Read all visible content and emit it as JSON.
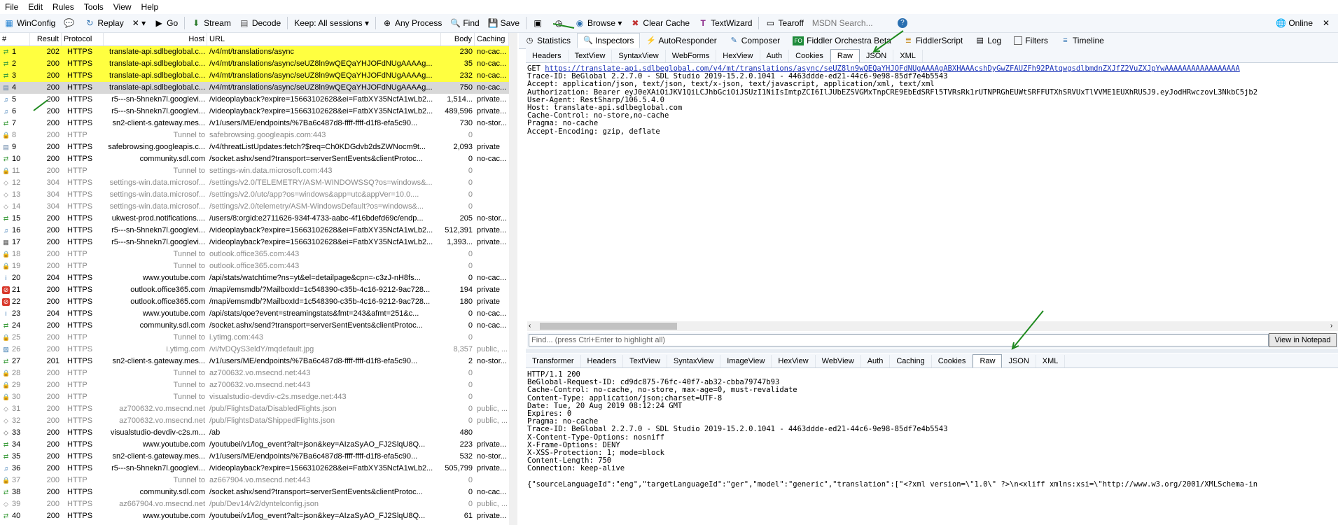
{
  "menu": [
    "File",
    "Edit",
    "Rules",
    "Tools",
    "View",
    "Help"
  ],
  "toolbar": {
    "winconfig": "WinConfig",
    "replay": "Replay",
    "remove": "✕ ▾",
    "go": "Go",
    "stream": "Stream",
    "decode": "Decode",
    "keep": "Keep: All sessions ▾",
    "any_process": "Any Process",
    "find": "Find",
    "save": "Save",
    "browse": "Browse ▾",
    "clear_cache": "Clear Cache",
    "textwizard": "TextWizard",
    "tearoff": "Tearoff",
    "msdn_search": "MSDN Search...",
    "online": "Online"
  },
  "columns": [
    "#",
    "Result",
    "Protocol",
    "Host",
    "URL",
    "Body",
    "Caching"
  ],
  "sessions": [
    {
      "id": "1",
      "result": "202",
      "protocol": "HTTPS",
      "host": "translate-api.sdlbeglobal.c...",
      "url": "/v4/mt/translations/async",
      "body": "230",
      "caching": "no-cac...",
      "style": "hl",
      "icon": "arrow",
      "color": "#3a9c3a"
    },
    {
      "id": "2",
      "result": "200",
      "protocol": "HTTPS",
      "host": "translate-api.sdlbeglobal.c...",
      "url": "/v4/mt/translations/async/seUZ8ln9wQEQaYHJOFdNUgAAAAg...",
      "body": "35",
      "caching": "no-cac...",
      "style": "hl",
      "icon": "arrow",
      "color": "#3a9c3a"
    },
    {
      "id": "3",
      "result": "200",
      "protocol": "HTTPS",
      "host": "translate-api.sdlbeglobal.c...",
      "url": "/v4/mt/translations/async/seUZ8ln9wQEQaYHJOFdNUgAAAAg...",
      "body": "232",
      "caching": "no-cac...",
      "style": "hl",
      "icon": "arrow",
      "color": "#3a9c3a"
    },
    {
      "id": "4",
      "result": "200",
      "protocol": "HTTPS",
      "host": "translate-api.sdlbeglobal.c...",
      "url": "/v4/mt/translations/async/seUZ8ln9wQEQaYHJOFdNUgAAAAg...",
      "body": "750",
      "caching": "no-cac...",
      "style": "sel",
      "icon": "doc",
      "color": "#5a7aa0"
    },
    {
      "id": "5",
      "result": "200",
      "protocol": "HTTPS",
      "host": "r5---sn-5hnekn7l.googlevi...",
      "url": "/videoplayback?expire=15663102628&ei=FatbXY35NcfA1wLb2...",
      "body": "1,514...",
      "caching": "private...",
      "style": "",
      "icon": "music",
      "color": "#2a6fb0"
    },
    {
      "id": "6",
      "result": "200",
      "protocol": "HTTPS",
      "host": "r5---sn-5hnekn7l.googlevi...",
      "url": "/videoplayback?expire=15663102628&ei=FatbXY35NcfA1wLb2...",
      "body": "489,596",
      "caching": "private...",
      "style": "",
      "icon": "music",
      "color": "#2a6fb0"
    },
    {
      "id": "7",
      "result": "200",
      "protocol": "HTTPS",
      "host": "sn2-client-s.gateway.mes...",
      "url": "/v1/users/ME/endpoints/%7Ba6c487d8-ffff-ffff-d1f8-efa5c90...",
      "body": "730",
      "caching": "no-stor...",
      "style": "",
      "icon": "arrow",
      "color": "#3a9c3a"
    },
    {
      "id": "8",
      "result": "200",
      "protocol": "HTTP",
      "host": "Tunnel to",
      "url": "safebrowsing.googleapis.com:443",
      "body": "0",
      "caching": "",
      "style": "grey",
      "icon": "lock",
      "color": "#888"
    },
    {
      "id": "9",
      "result": "200",
      "protocol": "HTTPS",
      "host": "safebrowsing.googleapis.c...",
      "url": "/v4/threatListUpdates:fetch?$req=Ch0KDGdvb2dsZWNocm9t...",
      "body": "2,093",
      "caching": "private",
      "style": "",
      "icon": "doc",
      "color": "#5a7aa0"
    },
    {
      "id": "10",
      "result": "200",
      "protocol": "HTTPS",
      "host": "community.sdl.com",
      "url": "/socket.ashx/send?transport=serverSentEvents&clientProtoc...",
      "body": "0",
      "caching": "no-cac...",
      "style": "",
      "icon": "arrow",
      "color": "#3a9c3a"
    },
    {
      "id": "11",
      "result": "200",
      "protocol": "HTTP",
      "host": "Tunnel to",
      "url": "settings-win.data.microsoft.com:443",
      "body": "0",
      "caching": "",
      "style": "grey",
      "icon": "lock",
      "color": "#888"
    },
    {
      "id": "12",
      "result": "304",
      "protocol": "HTTPS",
      "host": "settings-win.data.microsof...",
      "url": "/settings/v2.0/TELEMETRY/ASM-WINDOWSSQ?os=windows&...",
      "body": "0",
      "caching": "",
      "style": "grey",
      "icon": "diamond",
      "color": "#888"
    },
    {
      "id": "13",
      "result": "304",
      "protocol": "HTTPS",
      "host": "settings-win.data.microsof...",
      "url": "/settings/v2.0/utc/app?os=windows&app=utc&appVer=10.0....",
      "body": "0",
      "caching": "",
      "style": "grey",
      "icon": "diamond",
      "color": "#888"
    },
    {
      "id": "14",
      "result": "304",
      "protocol": "HTTPS",
      "host": "settings-win.data.microsof...",
      "url": "/settings/v2.0/telemetry/ASM-WindowsDefault?os=windows&...",
      "body": "0",
      "caching": "",
      "style": "grey",
      "icon": "diamond",
      "color": "#888"
    },
    {
      "id": "15",
      "result": "200",
      "protocol": "HTTPS",
      "host": "ukwest-prod.notifications....",
      "url": "/users/8:orgid:e2711626-934f-4733-aabc-4f16bdefd69c/endp...",
      "body": "205",
      "caching": "no-stor...",
      "style": "",
      "icon": "arrow",
      "color": "#3a9c3a"
    },
    {
      "id": "16",
      "result": "200",
      "protocol": "HTTPS",
      "host": "r5---sn-5hnekn7l.googlevi...",
      "url": "/videoplayback?expire=15663102628&ei=FatbXY35NcfA1wLb2...",
      "body": "512,391",
      "caching": "private...",
      "style": "",
      "icon": "music",
      "color": "#2a6fb0"
    },
    {
      "id": "17",
      "result": "200",
      "protocol": "HTTPS",
      "host": "r5---sn-5hnekn7l.googlevi...",
      "url": "/videoplayback?expire=15663102628&ei=FatbXY35NcfA1wLb2...",
      "body": "1,393...",
      "caching": "private...",
      "style": "",
      "icon": "film",
      "color": "#555"
    },
    {
      "id": "18",
      "result": "200",
      "protocol": "HTTP",
      "host": "Tunnel to",
      "url": "outlook.office365.com:443",
      "body": "0",
      "caching": "",
      "style": "grey",
      "icon": "lock",
      "color": "#888"
    },
    {
      "id": "19",
      "result": "200",
      "protocol": "HTTP",
      "host": "Tunnel to",
      "url": "outlook.office365.com:443",
      "body": "0",
      "caching": "",
      "style": "grey",
      "icon": "lock",
      "color": "#888"
    },
    {
      "id": "20",
      "result": "204",
      "protocol": "HTTPS",
      "host": "www.youtube.com",
      "url": "/api/stats/watchtime?ns=yt&el=detailpage&cpn=-c3zJ-nH8fs...",
      "body": "0",
      "caching": "no-cac...",
      "style": "",
      "icon": "info",
      "color": "#2a6fb0"
    },
    {
      "id": "21",
      "result": "200",
      "protocol": "HTTPS",
      "host": "outlook.office365.com",
      "url": "/mapi/emsmdb/?MailboxId=1c548390-c35b-4c16-9212-9ac728...",
      "body": "194",
      "caching": "private",
      "style": "",
      "icon": "stop",
      "color": "#d9382b"
    },
    {
      "id": "22",
      "result": "200",
      "protocol": "HTTPS",
      "host": "outlook.office365.com",
      "url": "/mapi/emsmdb/?MailboxId=1c548390-c35b-4c16-9212-9ac728...",
      "body": "180",
      "caching": "private",
      "style": "",
      "icon": "stop",
      "color": "#d9382b"
    },
    {
      "id": "23",
      "result": "204",
      "protocol": "HTTPS",
      "host": "www.youtube.com",
      "url": "/api/stats/qoe?event=streamingstats&fmt=243&afmt=251&c...",
      "body": "0",
      "caching": "no-cac...",
      "style": "",
      "icon": "info",
      "color": "#2a6fb0"
    },
    {
      "id": "24",
      "result": "200",
      "protocol": "HTTPS",
      "host": "community.sdl.com",
      "url": "/socket.ashx/send?transport=serverSentEvents&clientProtoc...",
      "body": "0",
      "caching": "no-cac...",
      "style": "",
      "icon": "arrow",
      "color": "#3a9c3a"
    },
    {
      "id": "25",
      "result": "200",
      "protocol": "HTTP",
      "host": "Tunnel to",
      "url": "i.ytimg.com:443",
      "body": "0",
      "caching": "",
      "style": "grey",
      "icon": "lock",
      "color": "#888"
    },
    {
      "id": "26",
      "result": "200",
      "protocol": "HTTPS",
      "host": "i.ytimg.com",
      "url": "/vi/fvDQyS3eldY/mqdefault.jpg",
      "body": "8,357",
      "caching": "public, ...",
      "style": "grey",
      "icon": "image",
      "color": "#3a7ab0"
    },
    {
      "id": "27",
      "result": "201",
      "protocol": "HTTPS",
      "host": "sn2-client-s.gateway.mes...",
      "url": "/v1/users/ME/endpoints/%7Ba6c487d8-ffff-ffff-d1f8-efa5c90...",
      "body": "2",
      "caching": "no-stor...",
      "style": "",
      "icon": "arrow",
      "color": "#3a9c3a"
    },
    {
      "id": "28",
      "result": "200",
      "protocol": "HTTP",
      "host": "Tunnel to",
      "url": "az700632.vo.msecnd.net:443",
      "body": "0",
      "caching": "",
      "style": "grey",
      "icon": "lock",
      "color": "#888"
    },
    {
      "id": "29",
      "result": "200",
      "protocol": "HTTP",
      "host": "Tunnel to",
      "url": "az700632.vo.msecnd.net:443",
      "body": "0",
      "caching": "",
      "style": "grey",
      "icon": "lock",
      "color": "#888"
    },
    {
      "id": "30",
      "result": "200",
      "protocol": "HTTP",
      "host": "Tunnel to",
      "url": "visualstudio-devdiv-c2s.msedge.net:443",
      "body": "0",
      "caching": "",
      "style": "grey",
      "icon": "lock",
      "color": "#888"
    },
    {
      "id": "31",
      "result": "200",
      "protocol": "HTTPS",
      "host": "az700632.vo.msecnd.net",
      "url": "/pub/FlightsData/DisabledFlights.json",
      "body": "0",
      "caching": "public, ...",
      "style": "grey",
      "icon": "diamond",
      "color": "#888"
    },
    {
      "id": "32",
      "result": "200",
      "protocol": "HTTPS",
      "host": "az700632.vo.msecnd.net",
      "url": "/pub/FlightsData/ShippedFlights.json",
      "body": "0",
      "caching": "public, ...",
      "style": "grey",
      "icon": "diamond",
      "color": "#888"
    },
    {
      "id": "33",
      "result": "200",
      "protocol": "HTTPS",
      "host": "visualstudio-devdiv-c2s.m...",
      "url": "/ab",
      "body": "480",
      "caching": "",
      "style": "",
      "icon": "diamond",
      "color": "#555"
    },
    {
      "id": "34",
      "result": "200",
      "protocol": "HTTPS",
      "host": "www.youtube.com",
      "url": "/youtubei/v1/log_event?alt=json&key=AIzaSyAO_FJ2SlqU8Q...",
      "body": "223",
      "caching": "private...",
      "style": "",
      "icon": "arrow",
      "color": "#3a9c3a"
    },
    {
      "id": "35",
      "result": "200",
      "protocol": "HTTPS",
      "host": "sn2-client-s.gateway.mes...",
      "url": "/v1/users/ME/endpoints/%7Ba6c487d8-ffff-ffff-d1f8-efa5c90...",
      "body": "532",
      "caching": "no-stor...",
      "style": "",
      "icon": "arrow",
      "color": "#3a9c3a"
    },
    {
      "id": "36",
      "result": "200",
      "protocol": "HTTPS",
      "host": "r5---sn-5hnekn7l.googlevi...",
      "url": "/videoplayback?expire=15663102628&ei=FatbXY35NcfA1wLb2...",
      "body": "505,799",
      "caching": "private...",
      "style": "",
      "icon": "music",
      "color": "#2a6fb0"
    },
    {
      "id": "37",
      "result": "200",
      "protocol": "HTTP",
      "host": "Tunnel to",
      "url": "az667904.vo.msecnd.net:443",
      "body": "0",
      "caching": "",
      "style": "grey",
      "icon": "lock",
      "color": "#888"
    },
    {
      "id": "38",
      "result": "200",
      "protocol": "HTTPS",
      "host": "community.sdl.com",
      "url": "/socket.ashx/send?transport=serverSentEvents&clientProtoc...",
      "body": "0",
      "caching": "no-cac...",
      "style": "",
      "icon": "arrow",
      "color": "#3a9c3a"
    },
    {
      "id": "39",
      "result": "200",
      "protocol": "HTTPS",
      "host": "az667904.vo.msecnd.net",
      "url": "/pub/Dev14/v2/dyntelconfig.json",
      "body": "0",
      "caching": "public, ...",
      "style": "grey",
      "icon": "diamond",
      "color": "#888"
    },
    {
      "id": "40",
      "result": "200",
      "protocol": "HTTPS",
      "host": "www.youtube.com",
      "url": "/youtubei/v1/log_event?alt=json&key=AIzaSyAO_FJ2SlqU8Q...",
      "body": "61",
      "caching": "private...",
      "style": "",
      "icon": "arrow",
      "color": "#3a9c3a"
    }
  ],
  "inspector_tabs": [
    "Statistics",
    "Inspectors",
    "AutoResponder",
    "Composer",
    "Fiddler Orchestra Beta",
    "FiddlerScript",
    "Log",
    "Filters",
    "Timeline"
  ],
  "request_tabs": [
    "Headers",
    "TextView",
    "SyntaxView",
    "WebForms",
    "HexView",
    "Auth",
    "Cookies",
    "Raw",
    "JSON",
    "XML"
  ],
  "response_tabs": [
    "Transformer",
    "Headers",
    "TextView",
    "SyntaxView",
    "ImageView",
    "HexView",
    "WebView",
    "Auth",
    "Caching",
    "Cookies",
    "Raw",
    "JSON",
    "XML"
  ],
  "request": {
    "method": "GET ",
    "url": "https://translate-api.sdlbeglobal.com/v4/mt/translations/async/seUZ8ln9wQEQaYHJOFdNUgAAAAgABXHAAAcshDyGwZFAUZFh92PAtqwgsdlbmdnZXJfZ2VuZXJpYwAAAAAAAAAAAAAAAAA",
    "lines": "Trace-ID: BeGlobal 2.2.7.0 - SDL Studio 2019-15.2.0.1041 - 4463ddde-ed21-44c6-9e98-85df7e4b5543\nAccept: application/json, text/json, text/x-json, text/javascript, application/xml, text/xml\nAuthorization: Bearer eyJ0eXAiOiJKV1QiLCJhbGciOiJSUzI1NiIsImtpZCI6IlJUbEZSVGMxTnpCRE9EbEdSRFl5TVRsRk1rUTNPRGhEUWtSRFFUTXhSRVUxTlVVME1EUXhRUSJ9.eyJodHRwczovL3NkbC5jb2\nUser-Agent: RestSharp/106.5.4.0\nHost: translate-api.sdlbeglobal.com\nCache-Control: no-store,no-cache\nPragma: no-cache\nAccept-Encoding: gzip, deflate"
  },
  "find_placeholder": "Find... (press Ctrl+Enter to highlight all)",
  "view_in_notepad": "View in Notepad",
  "response": {
    "lines": "HTTP/1.1 200\nBeGlobal-Request-ID: cd9dc875-76fc-40f7-ab32-cbba79747b93\nCache-Control: no-cache, no-store, max-age=0, must-revalidate\nContent-Type: application/json;charset=UTF-8\nDate: Tue, 20 Aug 2019 08:12:24 GMT\nExpires: 0\nPragma: no-cache\nTrace-ID: BeGlobal 2.2.7.0 - SDL Studio 2019-15.2.0.1041 - 4463ddde-ed21-44c6-9e98-85df7e4b5543\nX-Content-Type-Options: nosniff\nX-Frame-Options: DENY\nX-XSS-Protection: 1; mode=block\nContent-Length: 750\nConnection: keep-alive\n\n{\"sourceLanguageId\":\"eng\",\"targetLanguageId\":\"ger\",\"model\":\"generic\",\"translation\":[\"<?xml version=\\\"1.0\\\" ?>\\n<xliff xmlns:xsi=\\\"http://www.w3.org/2001/XMLSchema-in"
  },
  "colors": {
    "highlight": "#ffff40",
    "selected": "#d8d8d8",
    "link": "#1a33b8",
    "annotation_arrow": "#1f8a1f"
  }
}
